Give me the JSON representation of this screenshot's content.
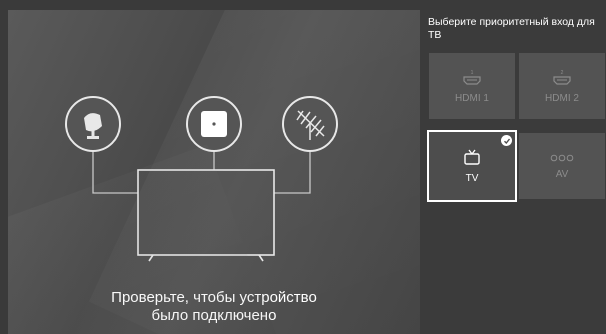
{
  "caption": {
    "line1": "Проверьте, чтобы устройство",
    "line2": "было подключено"
  },
  "panel": {
    "prompt": "Выберите приоритетный вход для ТВ"
  },
  "inputs": [
    {
      "label": "HDMI 1",
      "number": "1",
      "icon": "hdmi-icon",
      "state": "disabled"
    },
    {
      "label": "HDMI 2",
      "number": "2",
      "icon": "hdmi-icon",
      "state": "disabled"
    },
    {
      "label": "TV",
      "icon": "tv-icon",
      "state": "selected"
    },
    {
      "label": "AV",
      "icon": "av-icon",
      "state": "disabled"
    }
  ],
  "illustration": {
    "devices": [
      "satellite-dish-icon",
      "set-top-box-icon",
      "antenna-icon",
      "tv-screen"
    ]
  },
  "colors": {
    "background": "#3a3a3a",
    "tile": "#535353",
    "disabled_text": "#8c8c8c",
    "selected_border": "#ffffff"
  }
}
